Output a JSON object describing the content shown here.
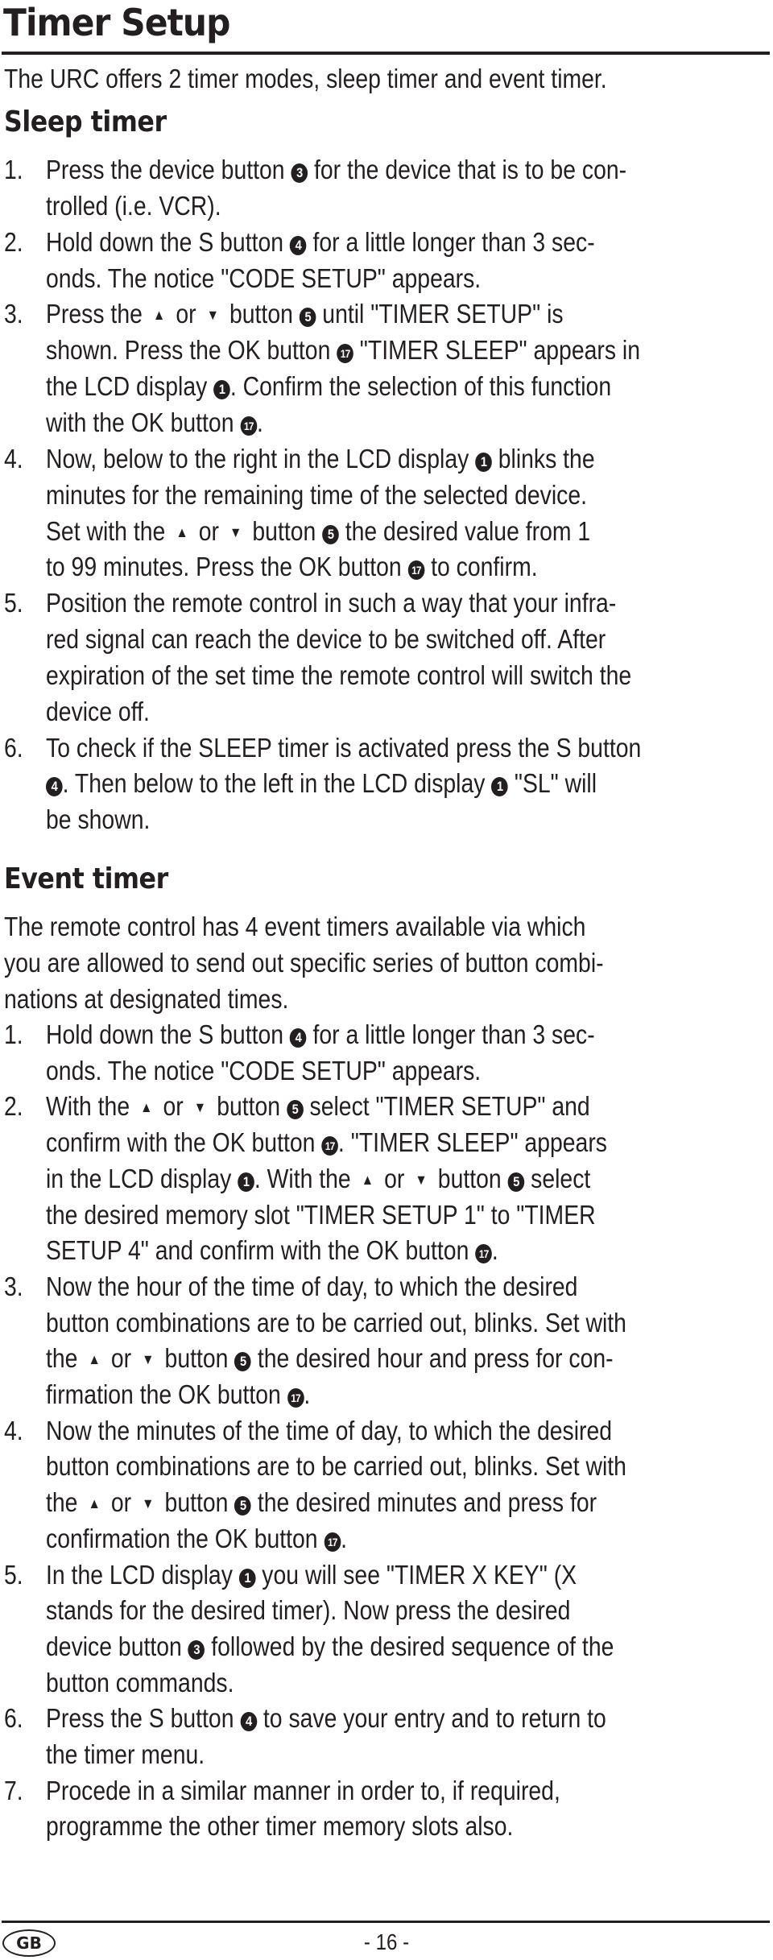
{
  "title": "Timer Setup",
  "intro": "The URC offers 2 timer modes, sleep timer and event timer.",
  "sleep": {
    "heading": "Sleep timer",
    "lines": [
      {
        "n": "1.",
        "t": [
          "Press the device button ",
          {
            "r": "3"
          },
          " for the device that is to be con-"
        ]
      },
      {
        "t": [
          "trolled (i.e. VCR)."
        ]
      },
      {
        "n": "2.",
        "t": [
          "Hold down the S button ",
          {
            "r": "4"
          },
          " for a little longer than 3 sec-"
        ]
      },
      {
        "t": [
          "onds. The notice \"CODE SETUP\" appears."
        ]
      },
      {
        "n": "3.",
        "t": [
          "Press the ",
          {
            "a": "up"
          },
          " or ",
          {
            "a": "down"
          },
          " button ",
          {
            "r": "5"
          },
          " until \"TIMER SETUP\" is"
        ]
      },
      {
        "t": [
          "shown. Press the OK button ",
          {
            "r": "17"
          },
          " \"TIMER SLEEP\" appears in"
        ]
      },
      {
        "t": [
          "the LCD display ",
          {
            "r": "1"
          },
          ". Confirm the selection of this function"
        ]
      },
      {
        "t": [
          "with the OK button ",
          {
            "r": "17"
          },
          "."
        ]
      },
      {
        "n": "4.",
        "t": [
          "Now, below to the right in the LCD display ",
          {
            "r": "1"
          },
          " blinks the"
        ]
      },
      {
        "t": [
          "minutes for the remaining time of the selected device."
        ]
      },
      {
        "t": [
          "Set with the ",
          {
            "a": "up"
          },
          " or ",
          {
            "a": "down"
          },
          " button ",
          {
            "r": "5"
          },
          " the desired value from 1"
        ]
      },
      {
        "t": [
          "to 99 minutes. Press the OK button ",
          {
            "r": "17"
          },
          " to confirm."
        ]
      },
      {
        "n": "5.",
        "t": [
          "Position the remote control in such a way that your infra-"
        ]
      },
      {
        "t": [
          "red signal can reach the device to be switched off. After"
        ]
      },
      {
        "t": [
          "expiration of the set time the remote control will switch the"
        ]
      },
      {
        "t": [
          "device off."
        ]
      },
      {
        "n": "6.",
        "t": [
          "To check if the SLEEP timer is activated press the S button"
        ]
      },
      {
        "t": [
          {
            "r": "4"
          },
          ". Then below to the left in the LCD display ",
          {
            "r": "1"
          },
          " \"SL\" will"
        ]
      },
      {
        "t": [
          "be shown."
        ]
      }
    ]
  },
  "event": {
    "heading": "Event timer",
    "intro_lines": [
      "The remote control has 4 event timers available via which",
      "you are allowed to send out specific series of button combi-",
      "nations at designated times."
    ],
    "lines": [
      {
        "n": "1.",
        "t": [
          "Hold down the S button ",
          {
            "r": "4"
          },
          " for a little longer than 3 sec-"
        ]
      },
      {
        "t": [
          "onds. The notice \"CODE SETUP\" appears."
        ]
      },
      {
        "n": "2.",
        "t": [
          "With the ",
          {
            "a": "up"
          },
          " or ",
          {
            "a": "down"
          },
          " button ",
          {
            "r": "5"
          },
          " select \"TIMER SETUP\" and"
        ]
      },
      {
        "t": [
          "confirm with the OK button ",
          {
            "r": "17"
          },
          ". \"TIMER SLEEP\" appears"
        ]
      },
      {
        "t": [
          "in the LCD display ",
          {
            "r": "1"
          },
          ".  With the ",
          {
            "a": "up"
          },
          " or ",
          {
            "a": "down"
          },
          " button ",
          {
            "r": "5"
          },
          " select"
        ]
      },
      {
        "t": [
          "the desired memory slot \"TIMER SETUP 1\" to \"TIMER"
        ]
      },
      {
        "t": [
          "SETUP 4\" and confirm with the OK button ",
          {
            "r": "17"
          },
          "."
        ]
      },
      {
        "n": "3.",
        "t": [
          "Now the hour of the time of day, to which the desired"
        ]
      },
      {
        "t": [
          "button combinations are to be carried out, blinks. Set with"
        ]
      },
      {
        "t": [
          "the ",
          {
            "a": "up"
          },
          " or ",
          {
            "a": "down"
          },
          " button ",
          {
            "r": "5"
          },
          " the desired hour and press for con-"
        ]
      },
      {
        "t": [
          "firmation the OK button ",
          {
            "r": "17"
          },
          "."
        ]
      },
      {
        "n": "4.",
        "t": [
          "Now the minutes of the time of day, to which the desired"
        ]
      },
      {
        "t": [
          "button combinations are to be carried out, blinks. Set with"
        ]
      },
      {
        "t": [
          "the ",
          {
            "a": "up"
          },
          " or ",
          {
            "a": "down"
          },
          " button ",
          {
            "r": "5"
          },
          " the desired minutes and press for"
        ]
      },
      {
        "t": [
          "confirmation the OK button ",
          {
            "r": "17"
          },
          "."
        ]
      },
      {
        "n": "5.",
        "t": [
          "In the LCD display ",
          {
            "r": "1"
          },
          " you will see \"TIMER X KEY\" (X"
        ]
      },
      {
        "t": [
          "stands for the desired timer). Now press the desired"
        ]
      },
      {
        "t": [
          "device button ",
          {
            "r": "3"
          },
          " followed by the desired sequence of the"
        ]
      },
      {
        "t": [
          "button commands."
        ]
      },
      {
        "n": "6.",
        "t": [
          "Press the S button ",
          {
            "r": "4"
          },
          " to save your entry and to return to"
        ]
      },
      {
        "t": [
          "the timer menu."
        ]
      },
      {
        "n": "7.",
        "t": [
          "Procede in a similar manner in order to, if required,"
        ]
      },
      {
        "t": [
          "programme the other timer memory slots also."
        ]
      }
    ]
  },
  "footer": {
    "country_badge": "GB",
    "page_number": "- 16 -"
  },
  "icons": {
    "up": "▲",
    "down": "▼"
  }
}
